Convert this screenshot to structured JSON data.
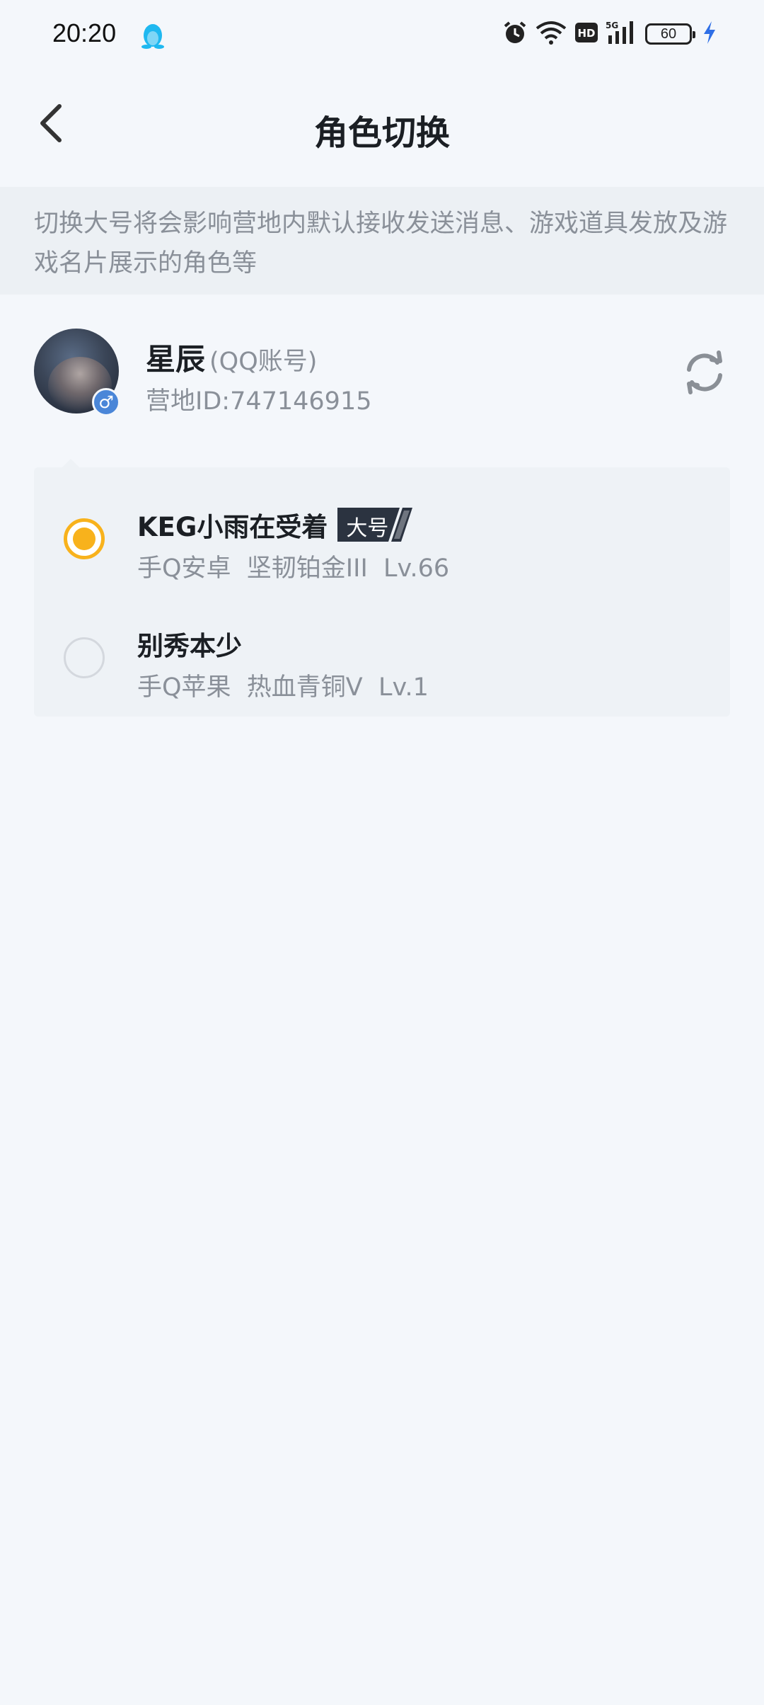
{
  "status_bar": {
    "time": "20:20",
    "battery": "60"
  },
  "header": {
    "title": "角色切换"
  },
  "notice": {
    "text": "切换大号将会影响营地内默认接收发送消息、游戏道具发放及游戏名片展示的角色等"
  },
  "account": {
    "name": "星辰",
    "type": "(QQ账号)",
    "id": "营地ID:747146915",
    "gender_symbol": "♂"
  },
  "roles": [
    {
      "name": "KEG小雨在受着",
      "badge": "大号",
      "info": "手Q安卓  坚韧铂金III  Lv.66",
      "selected": true
    },
    {
      "name": "别秀本少",
      "badge": "",
      "info": "手Q苹果  热血青铜V  Lv.1",
      "selected": false
    }
  ],
  "colors": {
    "accent": "#f8b21c",
    "background": "#f4f7fb",
    "notice_bg": "#ecf0f4",
    "secondary_text": "#8a9099"
  }
}
